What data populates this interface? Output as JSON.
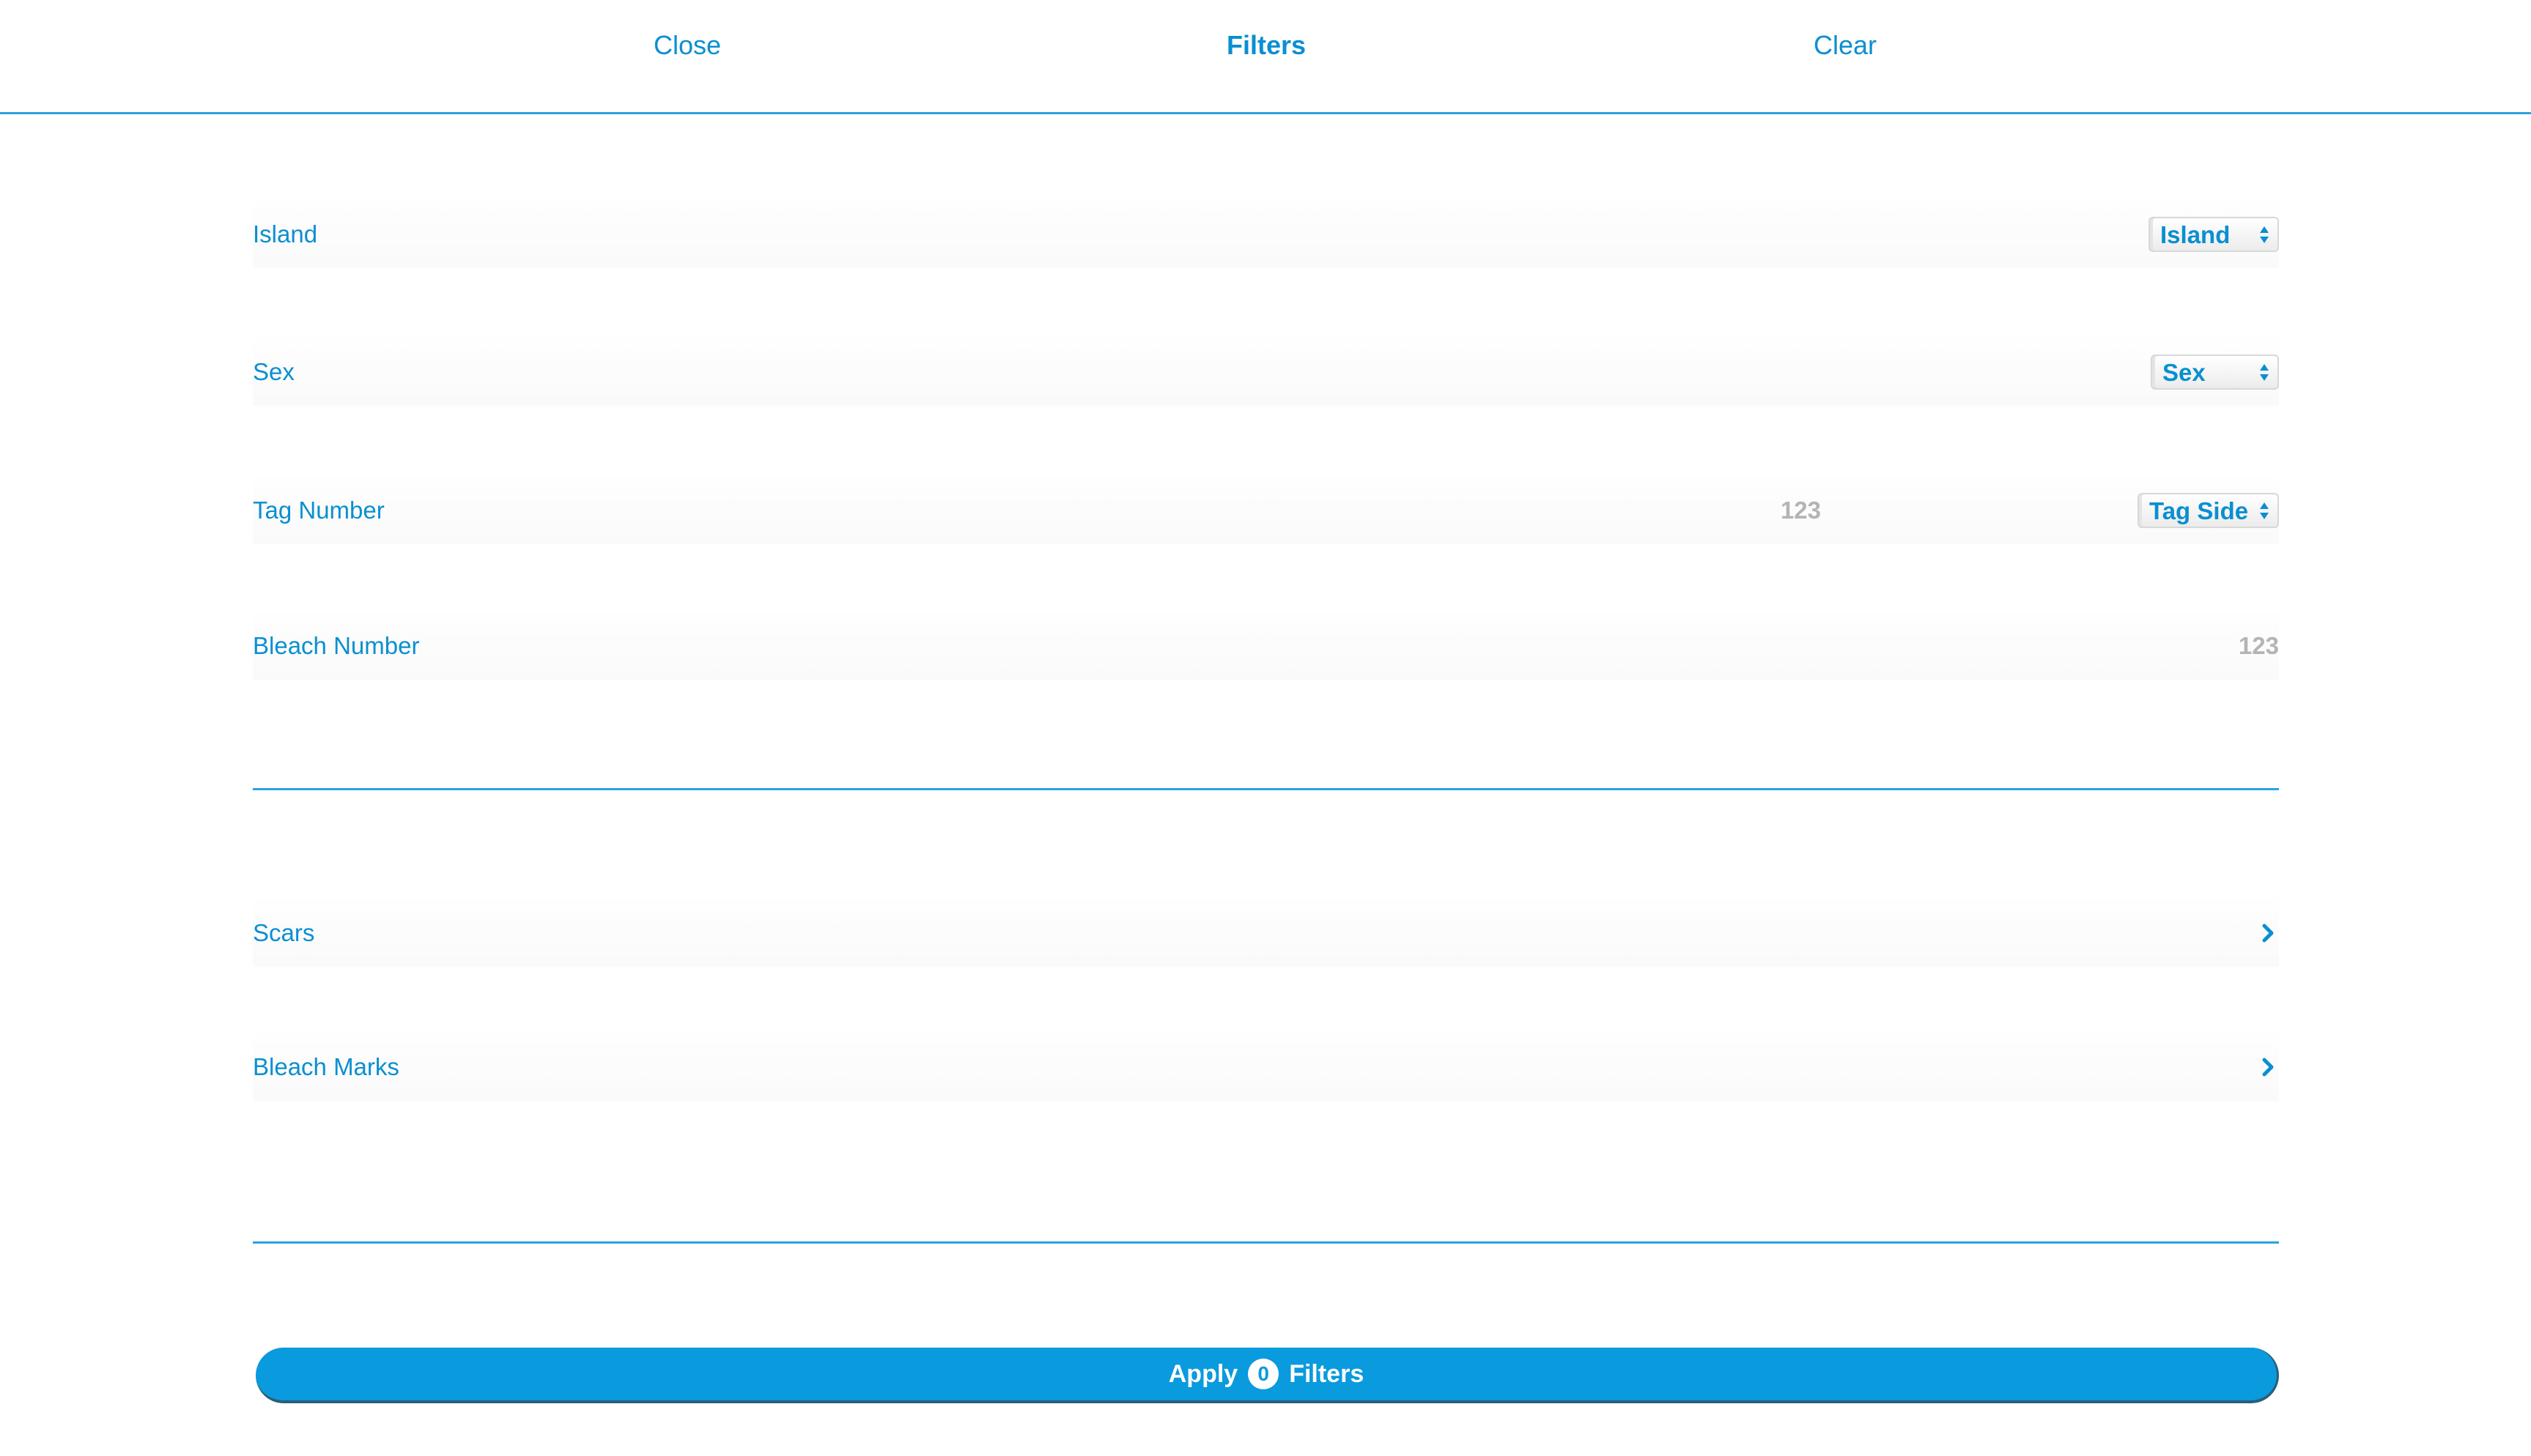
{
  "header": {
    "close_label": "Close",
    "title": "Filters",
    "clear_label": "Clear"
  },
  "filters": {
    "island": {
      "label": "Island",
      "select_value": "Island"
    },
    "sex": {
      "label": "Sex",
      "select_value": "Sex"
    },
    "tag_number": {
      "label": "Tag Number",
      "input_placeholder": "123",
      "select_value": "Tag Side"
    },
    "bleach_number": {
      "label": "Bleach Number",
      "input_placeholder": "123"
    }
  },
  "nav_rows": {
    "scars": {
      "label": "Scars",
      "icon": "chevron-right-icon"
    },
    "bleach_marks": {
      "label": "Bleach Marks",
      "icon": "chevron-right-icon"
    }
  },
  "apply": {
    "prefix": "Apply",
    "count": "0",
    "suffix": "Filters"
  },
  "colors": {
    "accent": "#0a8fd1",
    "button": "#0a9ade",
    "placeholder": "#b4b4b4"
  }
}
